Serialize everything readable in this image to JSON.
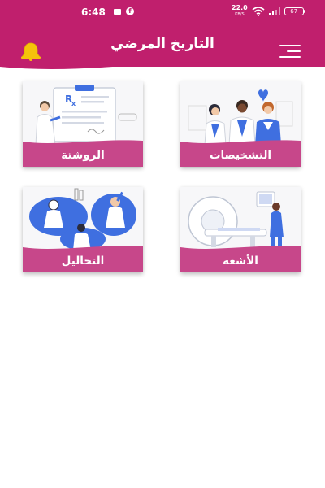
{
  "status_bar": {
    "time": "6:48",
    "speed_value": "22.0",
    "speed_unit": "KB/S",
    "battery": "67"
  },
  "header": {
    "title": "التاريخ المرضي",
    "bell_icon": "bell-icon",
    "menu_icon": "hamburger-menu-icon"
  },
  "colors": {
    "primary": "#c01f6d",
    "card_label": "#c7478a",
    "bell": "#f5c20b",
    "illustration_blue": "#3f6fe0"
  },
  "cards": [
    {
      "label": "التشخيصات",
      "icon": "doctors-team-illustration"
    },
    {
      "label": "الروشتة",
      "icon": "prescription-illustration"
    },
    {
      "label": "الأشعة",
      "icon": "mri-scan-illustration"
    },
    {
      "label": "التحاليل",
      "icon": "lab-tests-illustration"
    }
  ]
}
